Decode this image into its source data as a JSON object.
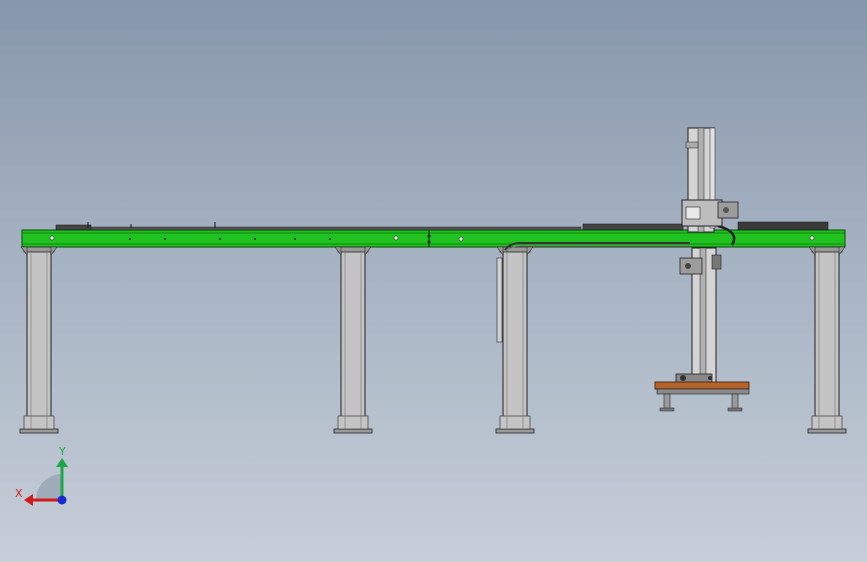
{
  "view": {
    "background_top": "#8797ab",
    "background_bottom": "#c6ced8",
    "beam_color": "#1fc21f",
    "column_color": "#c4c4c4",
    "pallet_color": "#b4642a",
    "line_color": "#111111"
  },
  "model": {
    "name": "gantry-robot-assembly",
    "columns": 4,
    "vertical_axes": 1,
    "pallets": 1
  },
  "triad": {
    "x_label": "X",
    "y_label": "Y",
    "x_color": "#d11a1a",
    "y_color": "#1aa84a",
    "z_color": "#1a2ad1"
  }
}
